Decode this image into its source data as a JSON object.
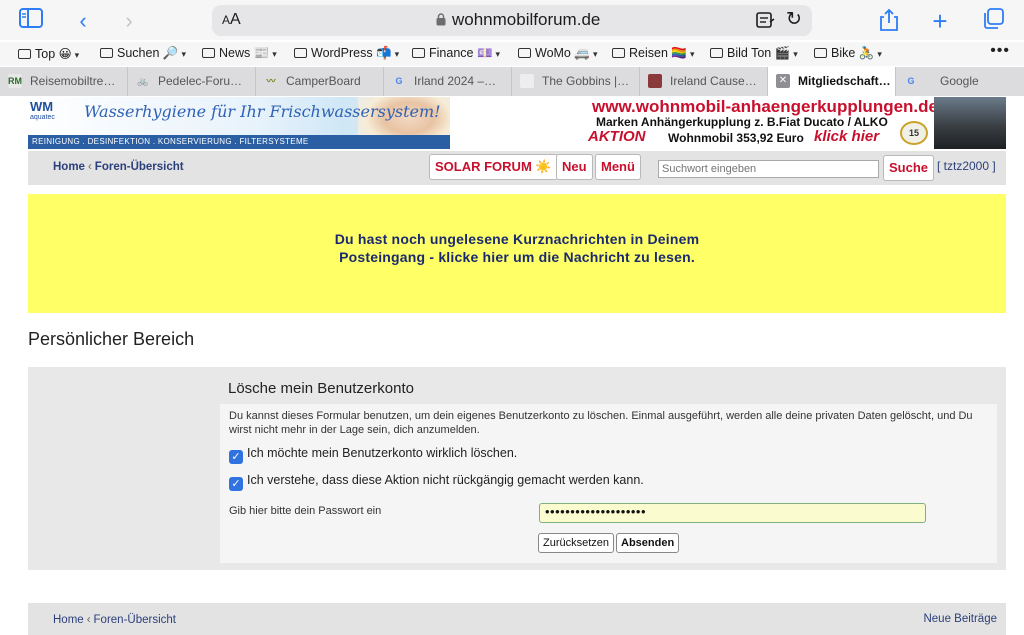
{
  "browser": {
    "text_size_label": "AA",
    "url": "wohnmobilforum.de",
    "bookmarks": [
      {
        "label": "Top 😀"
      },
      {
        "label": "Suchen 🔎"
      },
      {
        "label": "News 📰"
      },
      {
        "label": "WordPress 📬"
      },
      {
        "label": "Finance 💷"
      },
      {
        "label": "WoMo 🚐"
      },
      {
        "label": "Reisen 🏳️‍🌈"
      },
      {
        "label": "Bild Ton 🎬"
      },
      {
        "label": "Bike 🚴"
      }
    ],
    "more_label": "•••",
    "tabs": [
      {
        "label": "Reisemobiltre…",
        "favicon": "RM"
      },
      {
        "label": "Pedelec-Foru…",
        "favicon": "🚲"
      },
      {
        "label": "CamperBoard",
        "favicon": "〰"
      },
      {
        "label": "Irland 2024 –…",
        "favicon": "G"
      },
      {
        "label": "The Gobbins |…",
        "favicon": ""
      },
      {
        "label": "Ireland Cause…",
        "favicon": ""
      },
      {
        "label": "Mitgliedschaft…",
        "favicon": "✕"
      },
      {
        "label": "Google",
        "favicon": "G"
      }
    ]
  },
  "banners": {
    "left": {
      "logo": "WM",
      "logo_sub": "aquatec",
      "slogan": "Wasserhygiene für Ihr Frischwassersystem!",
      "strip": "REINIGUNG . DESINFEKTION . KONSERVIERUNG . FILTERSYSTEME"
    },
    "right": {
      "line1": "www.wohnmobil-anhaengerkupplungen.de",
      "line2": "Marken Anhängerkupplung z. B.Fiat Ducato / ALKO",
      "aktion": "AKTION",
      "price": "Wohnmobil 353,92 Euro",
      "cta": "klick hier",
      "badge": "15"
    }
  },
  "nav": {
    "home": "Home",
    "forum_overview": "Foren-Übersicht",
    "solar_forum": "SOLAR FORUM ☀️",
    "new": "Neu",
    "menu": "Menü",
    "search_placeholder": "Suchwort eingeben",
    "search_button": "Suche",
    "user": "[ tztz2000 ]"
  },
  "notice": {
    "line1": "Du hast noch ungelesene Kurznachrichten in Deinem",
    "line2": "Posteingang - klicke hier um die Nachricht zu lesen."
  },
  "page": {
    "section_title": "Persönlicher Bereich",
    "panel_title": "Lösche mein Benutzerkonto",
    "description": "Du kannst dieses Formular benutzen, um dein eigenes Benutzerkonto zu löschen. Einmal ausgeführt, werden alle deine privaten Daten gelöscht, und Du wirst nicht mehr in der Lage sein, dich anzumelden.",
    "checkbox1": "Ich möchte mein Benutzerkonto wirklich löschen.",
    "checkbox2": "Ich verstehe, dass diese Aktion nicht rückgängig gemacht werden kann.",
    "password_label": "Gib hier bitte dein Passwort ein",
    "password_value": "••••••••••••••••••••",
    "reset_button": "Zurücksetzen",
    "submit_button": "Absenden"
  },
  "footer": {
    "home": "Home",
    "forum_overview": "Foren-Übersicht",
    "new_posts": "Neue Beiträge"
  }
}
